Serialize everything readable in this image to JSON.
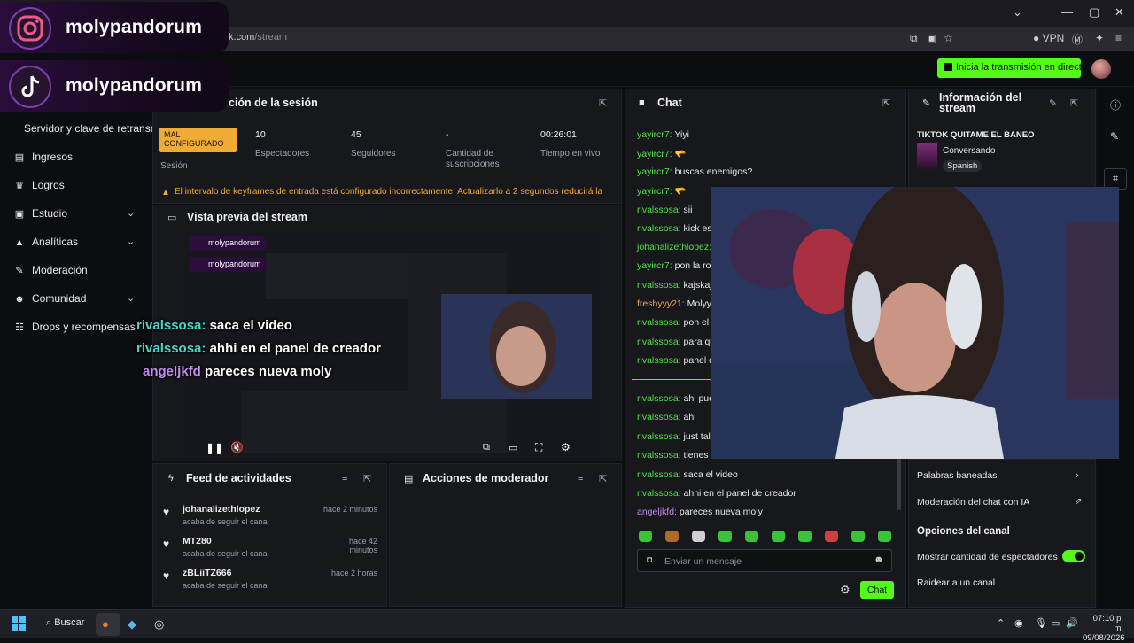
{
  "browser": {
    "url_prefix": "k.com",
    "url_path": "/stream",
    "vpn_label": "VPN"
  },
  "topbar": {
    "go_live_label": "Inicia la transmisión en directo"
  },
  "overlays": {
    "instagram_handle": "molypandorum",
    "tiktok_handle": "molypandorum"
  },
  "sidebar": {
    "truncated_item": "Servidor y clave de retransmisión",
    "items": [
      {
        "label": "Ingresos",
        "icon": "money-icon",
        "expandable": false
      },
      {
        "label": "Logros",
        "icon": "trophy-icon",
        "expandable": false
      },
      {
        "label": "Estudio",
        "icon": "studio-icon",
        "expandable": true
      },
      {
        "label": "Analíticas",
        "icon": "analytics-icon",
        "expandable": true
      },
      {
        "label": "Moderación",
        "icon": "hammer-icon",
        "expandable": false
      },
      {
        "label": "Comunidad",
        "icon": "community-icon",
        "expandable": true
      },
      {
        "label": "Drops y recompensas",
        "icon": "drops-icon",
        "expandable": false
      }
    ]
  },
  "session": {
    "title": "ción de la sesión",
    "status_badge": "MAL CONFIGURADO",
    "status_label": "Sesión",
    "stats": [
      {
        "value": "10",
        "label": "Espectadores"
      },
      {
        "value": "45",
        "label": "Seguidores"
      },
      {
        "value": "-",
        "label": "Cantidad de suscripciones"
      },
      {
        "value": "00:26:01",
        "label": "Tiempo en vivo"
      }
    ],
    "warning": "El intervalo de keyframes de entrada está configurado incorrectamente. Actualizarlo a 2 segundos reducirá la"
  },
  "preview": {
    "title": "Vista previa del stream"
  },
  "overlay_chat": [
    {
      "user": "rivalssosa:",
      "msg": "saca el video",
      "color": "#48d7c8"
    },
    {
      "user": "rivalssosa:",
      "msg": "ahhi en el panel de creador",
      "color": "#48d7c8"
    },
    {
      "user": "angeljkfd",
      "msg": "pareces nueva moly",
      "color": "#c48cf3"
    }
  ],
  "feed": {
    "title": "Feed de actividades",
    "items": [
      {
        "name": "johanalizethlopez",
        "sub": "acaba de seguir el canal",
        "time": "hace 2 minutos"
      },
      {
        "name": "MT280",
        "sub": "acaba de seguir el canal",
        "time": "hace 42 minutos"
      },
      {
        "name": "zBLiiTZ666",
        "sub": "acaba de seguir el canal",
        "time": "hace 2 horas"
      }
    ]
  },
  "modactions": {
    "title": "Acciones de moderador"
  },
  "chat": {
    "title": "Chat",
    "lines": [
      {
        "user": "yayircr7:",
        "msg": "Yiyi",
        "cls": "u-green"
      },
      {
        "user": "yayircr7:",
        "msg": "",
        "cls": "u-green",
        "emote": true
      },
      {
        "user": "yayircr7:",
        "msg": "buscas enemigos?",
        "cls": "u-green"
      },
      {
        "user": "yayircr7:",
        "msg": "",
        "cls": "u-green",
        "emote": true
      },
      {
        "user": "rivalssosa:",
        "msg": "sii",
        "cls": "u-green"
      },
      {
        "user": "rivalssosa:",
        "msg": "kick es",
        "cls": "u-green"
      },
      {
        "user": "johanalizethlopez:",
        "msg": "",
        "cls": "u-green"
      },
      {
        "user": "yayircr7:",
        "msg": "pon la ros",
        "cls": "u-green"
      },
      {
        "user": "rivalssosa:",
        "msg": "kajskaja",
        "cls": "u-green"
      },
      {
        "user": "freshyyy21:",
        "msg": "Molyyy",
        "cls": "u-orange"
      },
      {
        "user": "rivalssosa:",
        "msg": "pon el c",
        "cls": "u-green"
      },
      {
        "user": "rivalssosa:",
        "msg": "para qu",
        "cls": "u-green"
      },
      {
        "user": "rivalssosa:",
        "msg": "panel d",
        "cls": "u-green"
      },
      {
        "user": "rivalssosa:",
        "msg": "ahi pue",
        "cls": "u-green"
      },
      {
        "user": "rivalssosa:",
        "msg": "ahi",
        "cls": "u-green"
      },
      {
        "user": "rivalssosa:",
        "msg": "just talk",
        "cls": "u-green"
      },
      {
        "user": "rivalssosa:",
        "msg": "tienes e",
        "cls": "u-green"
      },
      {
        "user": "rivalssosa:",
        "msg": "saca el video",
        "cls": "u-green"
      },
      {
        "user": "rivalssosa:",
        "msg": "ahhi en el panel de creador",
        "cls": "u-green"
      },
      {
        "user": "angeljkfd:",
        "msg": "pareces nueva moly",
        "cls": "u-purple"
      }
    ],
    "input_placeholder": "Enviar un mensaje",
    "send_label": "Chat"
  },
  "info": {
    "title_line1": "Información del",
    "title_line2": "stream",
    "stream_title": "TIKTOK QUITAME EL BANEO",
    "category": "Conversando",
    "language": "Spanish"
  },
  "settings": {
    "banned_words": "Palabras baneadas",
    "ai_mod": "Moderación del chat con IA",
    "channel_options": "Opciones del canal",
    "show_viewers": "Mostrar cantidad de espectadores",
    "show_viewers_on": true,
    "raid": "Raidear a un canal"
  },
  "taskbar": {
    "search_label": "Buscar",
    "time": "07:10 p. m.",
    "date": "09/08/2026"
  },
  "colors": {
    "accent": "#53fc18",
    "warning": "#f0ab35",
    "panel": "#17181c"
  }
}
